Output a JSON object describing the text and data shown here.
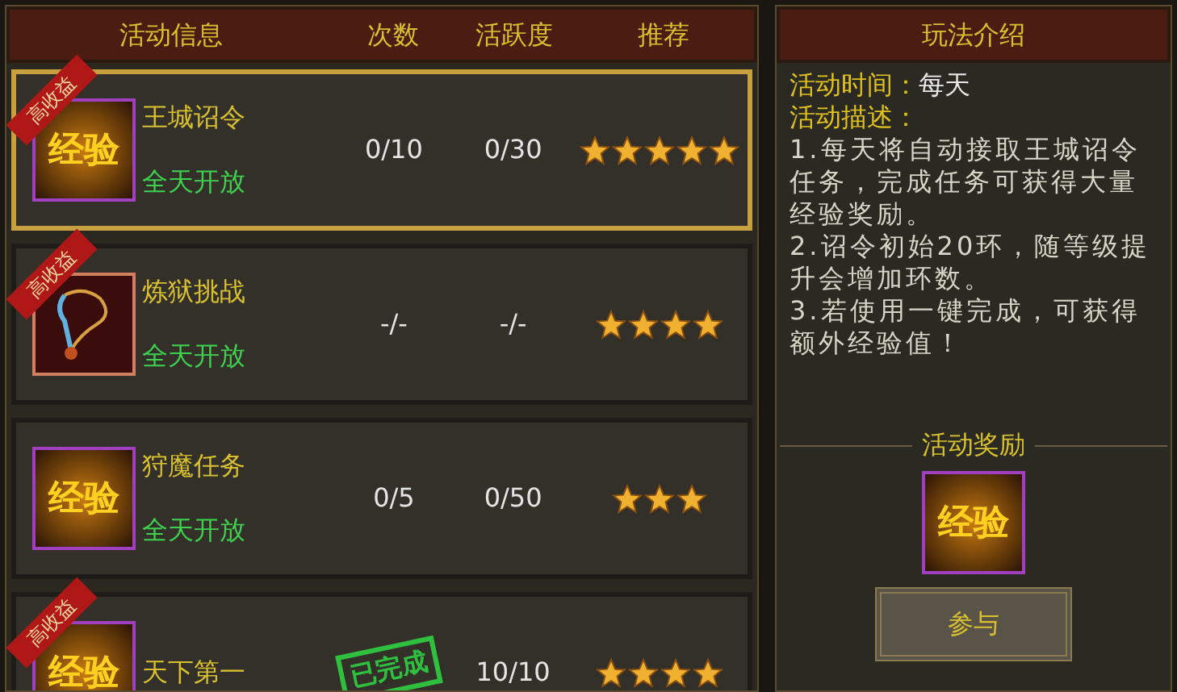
{
  "activity_list": {
    "columns": [
      "活动信息",
      "次数",
      "活跃度",
      "推荐"
    ],
    "rows": [
      {
        "selected": true,
        "high_yield": true,
        "badge": "高收益",
        "kind": "exp",
        "icon_text": "经验",
        "name": "王城诏令",
        "status": "全天开放",
        "count": "0/10",
        "activity": "0/30",
        "stars": 5,
        "completed": false
      },
      {
        "selected": false,
        "high_yield": true,
        "badge": "高收益",
        "kind": "necklace",
        "name": "炼狱挑战",
        "status": "全天开放",
        "count": "-/-",
        "activity": "-/-",
        "stars": 4,
        "completed": false
      },
      {
        "selected": false,
        "high_yield": false,
        "kind": "exp",
        "icon_text": "经验",
        "name": "狩魔任务",
        "status": "全天开放",
        "count": "0/5",
        "activity": "0/50",
        "stars": 3,
        "completed": false
      },
      {
        "selected": false,
        "high_yield": true,
        "badge": "高收益",
        "kind": "exp",
        "icon_text": "经验",
        "name": "天下第一",
        "activity": "10/10",
        "stars": 4,
        "completed": true,
        "stamp": "已完成"
      }
    ]
  },
  "intro": {
    "title": "玩法介绍",
    "time_label": "活动时间：",
    "time_value": "每天",
    "desc_label": "活动描述：",
    "desc_lines": [
      "1.每天将自动接取王城诏令任务，完成任务可获得大量经验奖励。",
      "2.诏令初始20环，随等级提升会增加环数。",
      "3.若使用一键完成，可获得额外经验值！"
    ],
    "reward_title": "活动奖励",
    "reward_icon_text": "经验",
    "button": "参与"
  }
}
